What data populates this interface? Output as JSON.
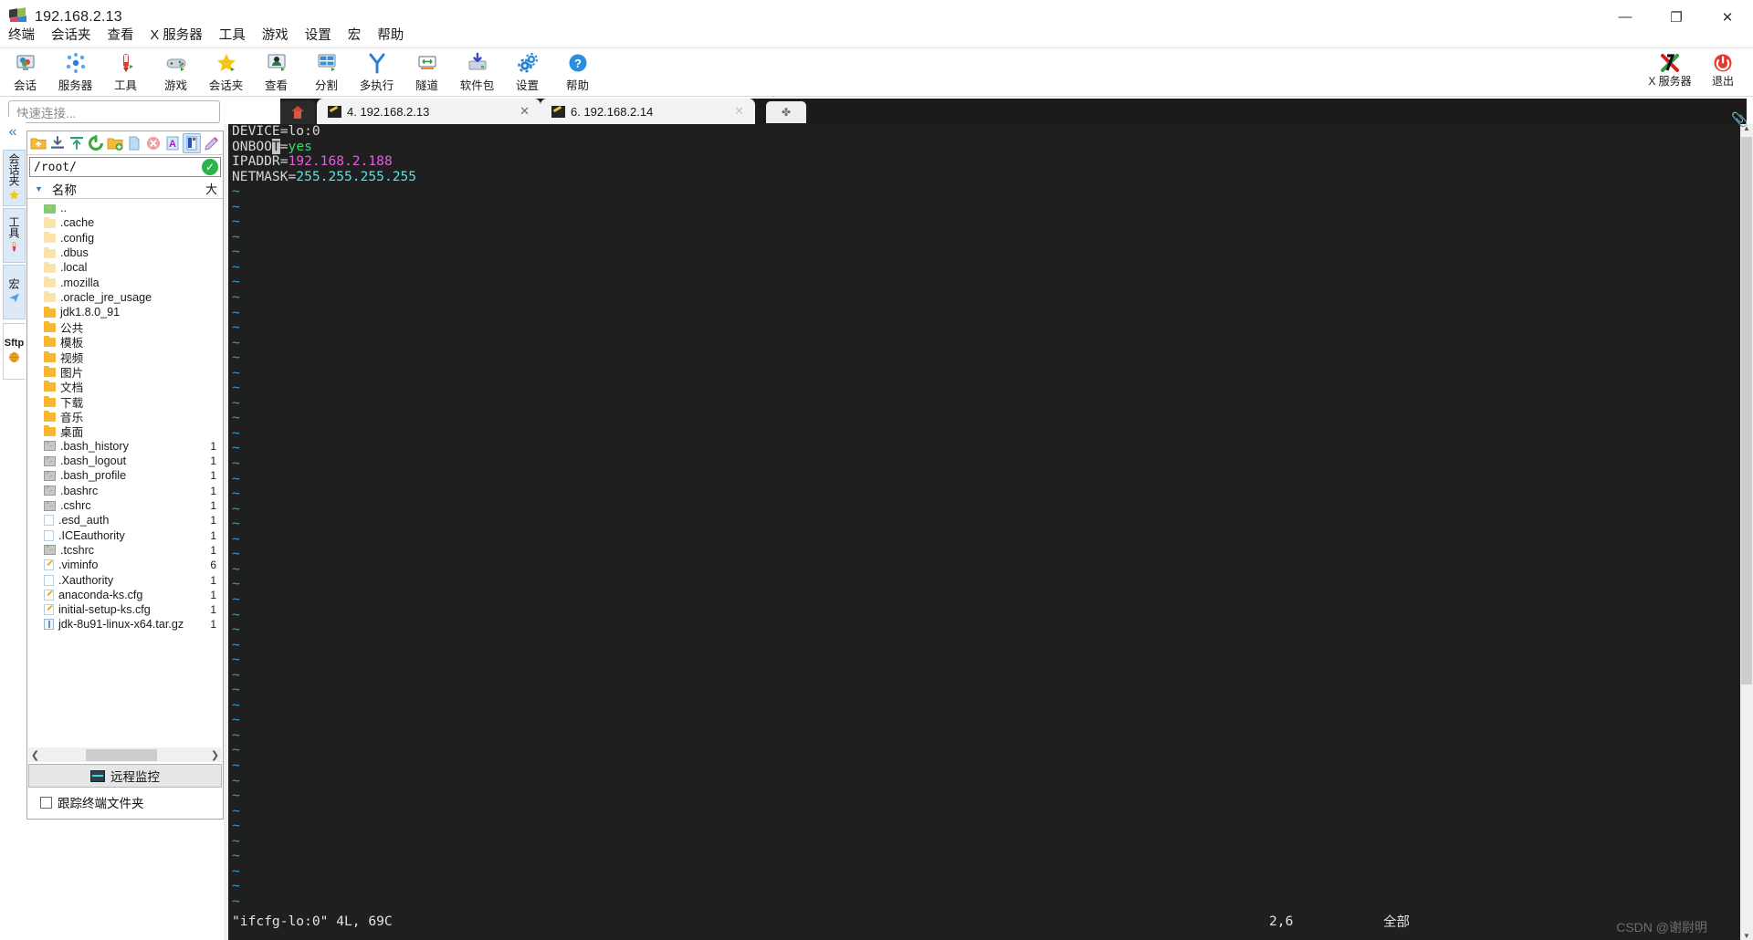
{
  "window": {
    "title": "192.168.2.13",
    "icon": "mobaxterm-logo-icon",
    "minimize": "—",
    "maximize": "❐",
    "close": "✕"
  },
  "menubar": {
    "items": [
      {
        "label": "终端",
        "name": "menu-terminal"
      },
      {
        "label": "会话夹",
        "name": "menu-sessions"
      },
      {
        "label": "查看",
        "name": "menu-view"
      },
      {
        "label": "X 服务器",
        "name": "menu-xserver"
      },
      {
        "label": "工具",
        "name": "menu-tools"
      },
      {
        "label": "游戏",
        "name": "menu-games"
      },
      {
        "label": "设置",
        "name": "menu-settings"
      },
      {
        "label": "宏",
        "name": "menu-macros"
      },
      {
        "label": "帮助",
        "name": "menu-help"
      }
    ]
  },
  "toolbar": {
    "buttons": [
      {
        "label": "会话",
        "icon": "session-icon",
        "name": "toolbar-session"
      },
      {
        "label": "服务器",
        "icon": "servers-icon",
        "name": "toolbar-servers"
      },
      {
        "label": "工具",
        "icon": "tools-icon",
        "name": "toolbar-tools"
      },
      {
        "label": "游戏",
        "icon": "games-icon",
        "name": "toolbar-games"
      },
      {
        "label": "会话夹",
        "icon": "star-icon",
        "name": "toolbar-sessions-folder"
      },
      {
        "label": "查看",
        "icon": "view-icon",
        "name": "toolbar-view"
      },
      {
        "label": "分割",
        "icon": "split-icon",
        "name": "toolbar-split"
      },
      {
        "label": "多执行",
        "icon": "multiexec-icon",
        "name": "toolbar-multiexec"
      },
      {
        "label": "隧道",
        "icon": "tunnel-icon",
        "name": "toolbar-tunneling"
      },
      {
        "label": "软件包",
        "icon": "packages-icon",
        "name": "toolbar-packages"
      },
      {
        "label": "设置",
        "icon": "settings-gear-icon",
        "name": "toolbar-settings"
      },
      {
        "label": "帮助",
        "icon": "help-question-icon",
        "name": "toolbar-help"
      }
    ],
    "right_buttons": [
      {
        "label": "X 服务器",
        "icon": "xserver-icon",
        "name": "toolbar-xserver"
      },
      {
        "label": "退出",
        "icon": "power-exit-icon",
        "name": "toolbar-exit"
      }
    ]
  },
  "quick_connect": {
    "placeholder": "快速连接...",
    "value": ""
  },
  "vertical_tabs": {
    "collapse_icon": "chevron-double-left-icon",
    "items": [
      {
        "label": "会话夹",
        "icon": "star-icon",
        "name": "vtab-sessions"
      },
      {
        "label": "工具",
        "icon": "tools-icon",
        "name": "vtab-tools"
      },
      {
        "label": "宏",
        "icon": "macro-plane-icon",
        "name": "vtab-macros"
      },
      {
        "label": "Sftp",
        "icon": "globe-icon",
        "name": "vtab-sftp"
      }
    ]
  },
  "file_panel": {
    "toolbar_icons": [
      {
        "icon": "go-up-folder-icon",
        "name": "fp-parent-dir"
      },
      {
        "icon": "download-icon",
        "name": "fp-download"
      },
      {
        "icon": "upload-icon",
        "name": "fp-upload"
      },
      {
        "icon": "refresh-icon",
        "name": "fp-refresh"
      },
      {
        "icon": "new-folder-icon",
        "name": "fp-new-folder"
      },
      {
        "icon": "new-file-icon",
        "name": "fp-new-file"
      },
      {
        "icon": "delete-icon",
        "name": "fp-delete"
      },
      {
        "icon": "text-mode-icon",
        "name": "fp-text-mode"
      },
      {
        "icon": "binary-mode-icon",
        "name": "fp-binary-mode"
      },
      {
        "icon": "edit-pencil-icon",
        "name": "fp-edit"
      }
    ],
    "path": "/root/",
    "path_ok_icon": "check-circle-icon",
    "columns": {
      "name": "名称",
      "size": "大"
    },
    "rows": [
      {
        "name": "..",
        "icon": "parent-folder-icon",
        "size": ""
      },
      {
        "name": ".cache",
        "icon": "folder-pale-icon",
        "size": ""
      },
      {
        "name": ".config",
        "icon": "folder-pale-icon",
        "size": ""
      },
      {
        "name": ".dbus",
        "icon": "folder-pale-icon",
        "size": ""
      },
      {
        "name": ".local",
        "icon": "folder-pale-icon",
        "size": ""
      },
      {
        "name": ".mozilla",
        "icon": "folder-pale-icon",
        "size": ""
      },
      {
        "name": ".oracle_jre_usage",
        "icon": "folder-pale-icon",
        "size": ""
      },
      {
        "name": "jdk1.8.0_91",
        "icon": "folder-icon",
        "size": ""
      },
      {
        "name": "公共",
        "icon": "folder-icon",
        "size": ""
      },
      {
        "name": "模板",
        "icon": "folder-icon",
        "size": ""
      },
      {
        "name": "视频",
        "icon": "folder-icon",
        "size": ""
      },
      {
        "name": "图片",
        "icon": "folder-icon",
        "size": ""
      },
      {
        "name": "文档",
        "icon": "folder-icon",
        "size": ""
      },
      {
        "name": "下载",
        "icon": "folder-icon",
        "size": ""
      },
      {
        "name": "音乐",
        "icon": "folder-icon",
        "size": ""
      },
      {
        "name": "桌面",
        "icon": "folder-icon",
        "size": ""
      },
      {
        "name": ".bash_history",
        "icon": "shell-file-icon",
        "size": "1"
      },
      {
        "name": ".bash_logout",
        "icon": "shell-file-icon",
        "size": "1"
      },
      {
        "name": ".bash_profile",
        "icon": "shell-file-icon",
        "size": "1"
      },
      {
        "name": ".bashrc",
        "icon": "shell-file-icon",
        "size": "1"
      },
      {
        "name": ".cshrc",
        "icon": "shell-file-icon",
        "size": "1"
      },
      {
        "name": ".esd_auth",
        "icon": "plain-file-icon",
        "size": "1"
      },
      {
        "name": ".ICEauthority",
        "icon": "plain-file-icon",
        "size": "1"
      },
      {
        "name": ".tcshrc",
        "icon": "shell-file-icon",
        "size": "1"
      },
      {
        "name": ".viminfo",
        "icon": "config-file-icon",
        "size": "6"
      },
      {
        "name": ".Xauthority",
        "icon": "plain-file-icon",
        "size": "1"
      },
      {
        "name": "anaconda-ks.cfg",
        "icon": "config-file-icon",
        "size": "1"
      },
      {
        "name": "initial-setup-ks.cfg",
        "icon": "config-file-icon",
        "size": "1"
      },
      {
        "name": "jdk-8u91-linux-x64.tar.gz",
        "icon": "archive-file-icon",
        "size": "1"
      }
    ],
    "remote_monitor_label": "远程监控",
    "remote_monitor_icon": "monitor-graph-icon",
    "follow_terminal_label": "跟踪终端文件夹",
    "follow_terminal_checked": false,
    "hscroll_left_icon": "chevron-left-icon",
    "hscroll_right_icon": "chevron-right-icon"
  },
  "tabbar": {
    "home_icon": "home-icon",
    "tabs": [
      {
        "label": "4. 192.168.2.13",
        "active": true,
        "close": "✕",
        "icon": "terminal-tab-icon",
        "name": "tab-session-4"
      },
      {
        "label": "6. 192.168.2.14",
        "active": false,
        "close": "✕",
        "icon": "terminal-tab-icon",
        "name": "tab-session-6"
      }
    ],
    "new_tab_icon": "✤"
  },
  "terminal": {
    "lines": [
      [
        {
          "t": "DEVICE=lo:0",
          "c": "key"
        }
      ],
      [
        {
          "t": "ONBOO",
          "c": "key"
        },
        {
          "t": "T",
          "c": "cursor"
        },
        {
          "t": "=",
          "c": "key"
        },
        {
          "t": "yes",
          "c": "green"
        }
      ],
      [
        {
          "t": "IPADDR=",
          "c": "key"
        },
        {
          "t": "192.168.2.188",
          "c": "magenta"
        }
      ],
      [
        {
          "t": "NETMASK=",
          "c": "key"
        },
        {
          "t": "255.255.255.255",
          "c": "cyan"
        }
      ]
    ],
    "tilde_char": "~",
    "tilde_count": 48,
    "status_file": "\"ifcfg-lo:0\" 4L, 69C",
    "status_position": "2,6",
    "status_scroll": "全部",
    "watermark": "CSDN @谢尉明"
  },
  "colors": {
    "terminal_bg": "#1f1f1f",
    "terminal_fg": "#d8d8d8",
    "green": "#2ee06a",
    "magenta": "#e85ce0",
    "cyan": "#5fe0e0",
    "tilde_blue": "#2f9fd8",
    "accent": "#2a7fd4"
  }
}
